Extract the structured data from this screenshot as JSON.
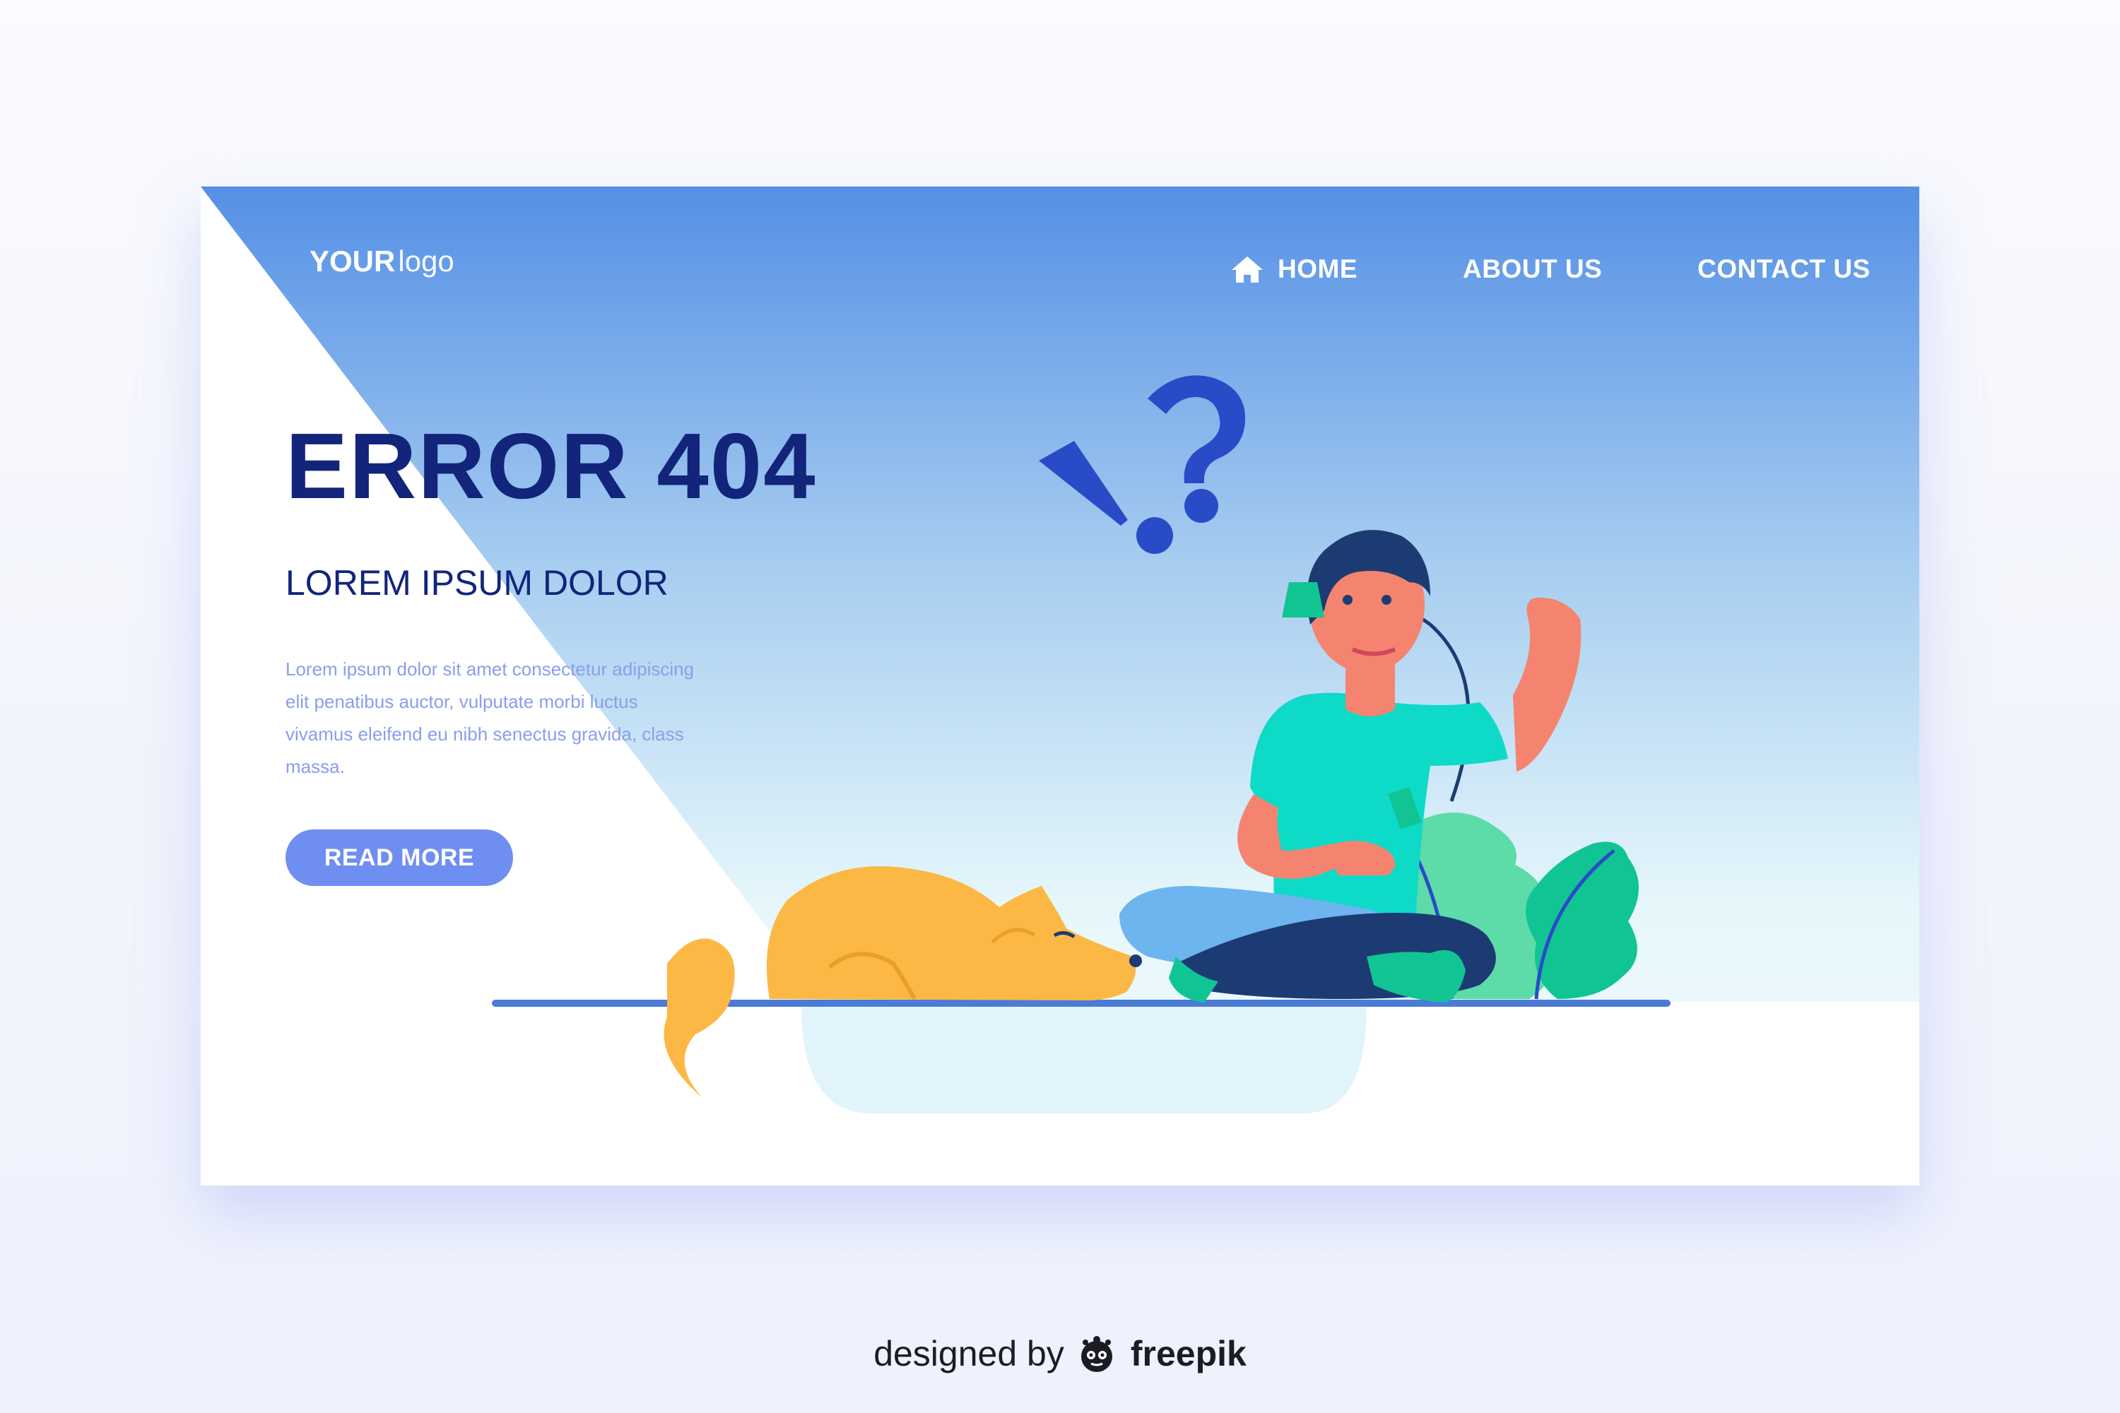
{
  "logo": {
    "bold": "YOUR",
    "thin": "logo"
  },
  "nav": {
    "home": "HOME",
    "about": "ABOUT US",
    "contact": "CONTACT US"
  },
  "hero": {
    "title": "ERROR 404",
    "subtitle": "LOREM IPSUM DOLOR",
    "body": "Lorem ipsum dolor sit amet consectetur adipiscing elit penatibus auctor, vulputate morbi luctus vivamus eleifend eu nibh senectus gravida, class massa.",
    "button": "READ MORE"
  },
  "footer": {
    "designed_by": "designed by",
    "brand": "freepik"
  },
  "icons": {
    "home": "home-icon",
    "exclamation": "exclamation-icon",
    "question": "question-mark-icon",
    "freepik": "freepik-logo-icon"
  },
  "colors": {
    "header_blue": "#5590e6",
    "title_navy": "#12257a",
    "body_text": "#8a9eec",
    "button": "#6f8ef1",
    "shirt": "#0edac8",
    "dog": "#fcb844",
    "leaf": "#5ddba8"
  }
}
